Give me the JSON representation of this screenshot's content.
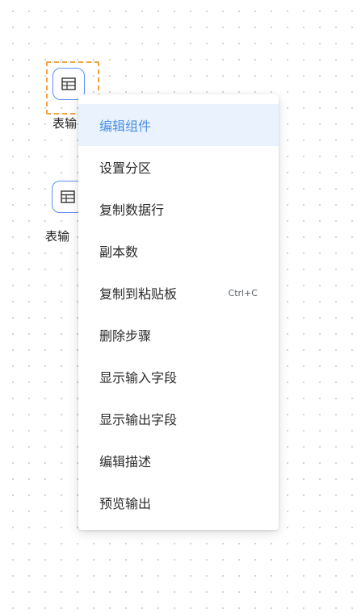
{
  "canvas": {
    "nodes": [
      {
        "label": "表输",
        "icon": "table-icon",
        "selected": true
      },
      {
        "label": "表输",
        "icon": "table-icon",
        "selected": false
      }
    ]
  },
  "context_menu": {
    "items": [
      {
        "label": "编辑组件",
        "active": true
      },
      {
        "label": "设置分区"
      },
      {
        "label": "复制数据行"
      },
      {
        "label": "副本数"
      },
      {
        "label": "复制到粘贴板",
        "shortcut": "Ctrl+C"
      },
      {
        "label": "删除步骤"
      },
      {
        "label": "显示输入字段"
      },
      {
        "label": "显示输出字段"
      },
      {
        "label": "编辑描述"
      },
      {
        "label": "预览输出"
      }
    ]
  },
  "colors": {
    "accent": "#4a90e2",
    "node_border": "#5b8ff9",
    "selection": "#f5a142",
    "active_bg": "#eaf2fe"
  }
}
